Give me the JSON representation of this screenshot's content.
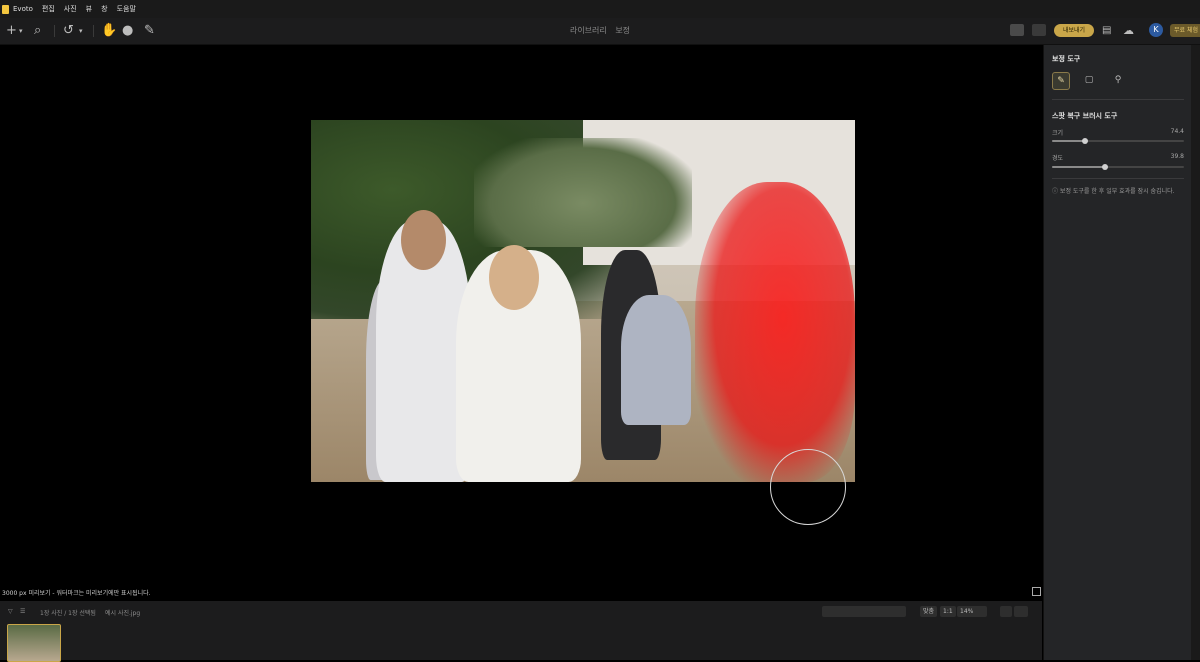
{
  "menubar": {
    "app": "Evoto",
    "items": [
      "편집",
      "사진",
      "뷰",
      "창",
      "도움말"
    ]
  },
  "toolbar": {
    "breadcrumb": [
      "라이브러리",
      "보정"
    ],
    "export_label": "내보내기",
    "avatar_initial": "K",
    "trial_label": "무료 체험"
  },
  "canvas": {
    "image_alt": "웨딩 단체 사진",
    "status": "3000 px 미리보기 - 워터마크는 미리보기에만 표시됩니다."
  },
  "filmstrip": {
    "count": "1장 사진 / 1장 선택됨",
    "filename": "예시 사진.jpg",
    "fit_label": "맞춤",
    "ratio_label": "1:1",
    "zoom": "14%"
  },
  "panel": {
    "title": "보정 도구",
    "section": "스팟 복구 브러시 도구",
    "sliders": [
      {
        "label": "크기",
        "value": "74.4",
        "fraction": 0.25
      },
      {
        "label": "경도",
        "value": "39.8",
        "fraction": 0.4
      }
    ],
    "note": "보정 도구를 한 후 일부 효과를 잠시 숨깁니다."
  },
  "colors": {
    "accent": "#c9a649",
    "mask": "#ff1414",
    "panel_bg": "#242527"
  }
}
